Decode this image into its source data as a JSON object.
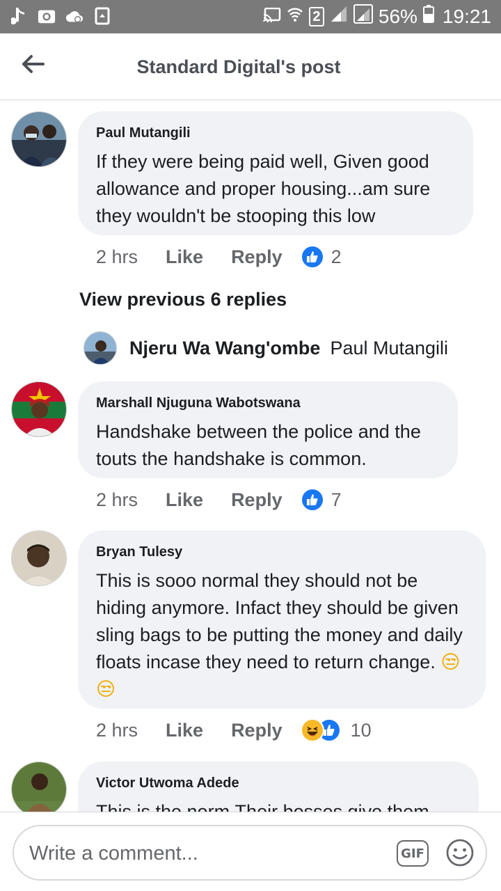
{
  "status_bar": {
    "battery": "56%",
    "time": "19:21",
    "sim_slot": "2",
    "icons": [
      "music-note-icon",
      "camera-icon",
      "cloud-icon",
      "recycle-icon",
      "cast-icon",
      "wifi-icon",
      "signal-icon",
      "battery-icon"
    ]
  },
  "header": {
    "title": "Standard Digital's post",
    "back_icon": "back-arrow-icon"
  },
  "comments": [
    {
      "author": "Paul Mutangili",
      "text": "If they were being paid well, Given good allowance and proper housing...am sure they wouldn't be stooping this low",
      "time": "2 hrs",
      "like_label": "Like",
      "reply_label": "Reply",
      "reaction_count": "2",
      "reactions": [
        "like"
      ]
    },
    {
      "author": "Marshall Njuguna Wabotswana",
      "text": "Handshake between the police and the touts the handshake is common.",
      "time": "2 hrs",
      "like_label": "Like",
      "reply_label": "Reply",
      "reaction_count": "7",
      "reactions": [
        "like"
      ]
    },
    {
      "author": "Bryan Tulesy",
      "text": "This is sooo normal they should not be hiding anymore. Infact they should be given sling bags to be putting the money and daily floats incase they need to return change.",
      "emojis": "😒😒",
      "time": "2 hrs",
      "like_label": "Like",
      "reply_label": "Reply",
      "reaction_count": "10",
      "reactions": [
        "haha",
        "like"
      ]
    },
    {
      "author": "Victor Utwoma Adede",
      "text": "This is the norm.Their bosses give them"
    }
  ],
  "view_previous": "View previous 6 replies",
  "reply_preview": {
    "author": "Njeru Wa Wang'ombe",
    "text": "Paul Mutangili"
  },
  "composer": {
    "placeholder": "Write a comment...",
    "gif_label": "GIF",
    "emoji_icon": "smiley-icon"
  },
  "colors": {
    "status_bar": "#7a7a7a",
    "bubble": "#f0f2f5",
    "like_blue": "#1877f2",
    "haha_yellow": "#f7b928",
    "text_primary": "#1c1e21",
    "text_secondary": "#65676b"
  }
}
